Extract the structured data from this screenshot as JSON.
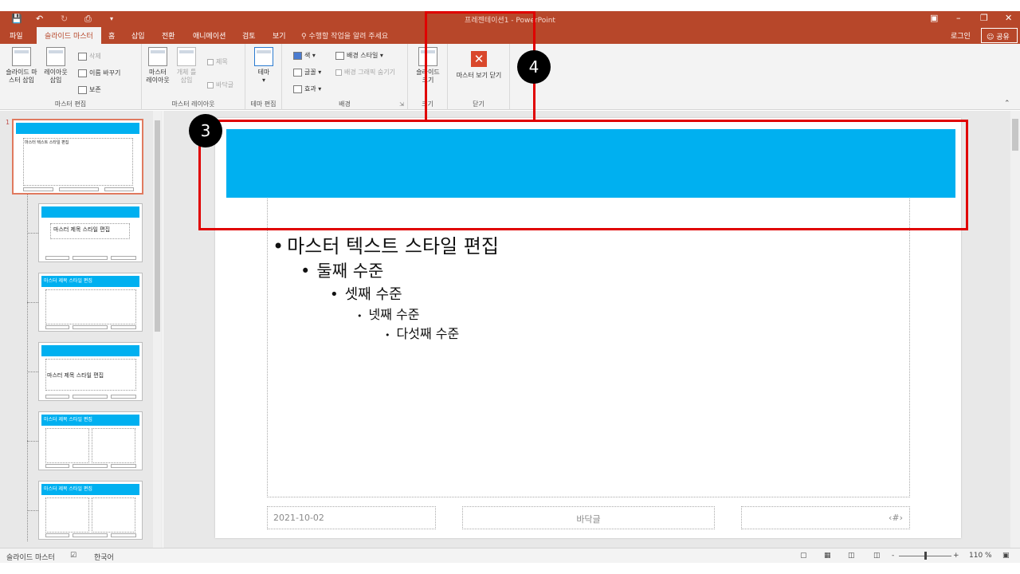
{
  "window": {
    "title": "프레젠테이션1 - PowerPoint",
    "quick_access": {
      "save_icon": "save-icon",
      "undo_icon": "undo-icon",
      "redo_icon": "redo-icon",
      "start_icon": "start-from-beginning-icon",
      "customize": "▾"
    }
  },
  "tabs": {
    "items": [
      "파일",
      "슬라이드 마스터",
      "홈",
      "삽입",
      "전환",
      "애니메이션",
      "검토",
      "보기"
    ],
    "active": "슬라이드 마스터",
    "tell_me": "수행할 작업을 알려 주세요",
    "login": "로그인",
    "share": "공유"
  },
  "ribbon": {
    "master_edit": {
      "label": "마스터 편집",
      "insert_master": "슬라이드 마\n스터 삽입",
      "insert_layout": "레이아웃\n삽입",
      "delete": "삭제",
      "rename": "이름 바꾸기",
      "preserve": "보존"
    },
    "master_layout": {
      "label": "마스터 레이아웃",
      "master_layout_btn": "마스터\n레이아웃",
      "insert_placeholder": "개체 틀\n삽입",
      "title_chk": "제목",
      "footer_chk": "바닥글"
    },
    "theme_edit": {
      "label": "테마 편집",
      "theme": "테마"
    },
    "background": {
      "label": "배경",
      "colors": "색",
      "fonts": "글꼴",
      "effects": "효과",
      "bg_styles": "배경 스타일",
      "hide_bg": "배경 그래픽 숨기기"
    },
    "size": {
      "label": "크기",
      "slide_size": "슬라이드\n크기"
    },
    "close": {
      "label": "닫기",
      "close_master": "마스터 보기 닫기"
    }
  },
  "thumbnails": {
    "first_number": "1",
    "items": [
      {
        "title": "마스터 텍스트 스타일 편집"
      },
      {
        "title": "마스터 제목 스타일 편집"
      },
      {
        "title": "마스터 제목 스타일 편집"
      },
      {
        "title": "마스터 제목 스타일 편집"
      },
      {
        "title": "마스터 제목 스타일 편집"
      },
      {
        "title": "마스터 제목 스타일 편집"
      }
    ]
  },
  "slide": {
    "bullets": [
      "마스터 텍스트 스타일 편집",
      "둘째 수준",
      "셋째 수준",
      "넷째 수준",
      "다섯째 수준"
    ],
    "footer_date": "2021-10-02",
    "footer_text": "바닥글",
    "footer_page": "‹#›"
  },
  "callouts": {
    "badge3": "3",
    "badge4": "4"
  },
  "status": {
    "view": "슬라이드 마스터",
    "language": "한국어",
    "zoom": "110 %"
  },
  "colors": {
    "accent": "#b7472a",
    "title_bar": "#00b0f0",
    "callout": "#e00000"
  }
}
